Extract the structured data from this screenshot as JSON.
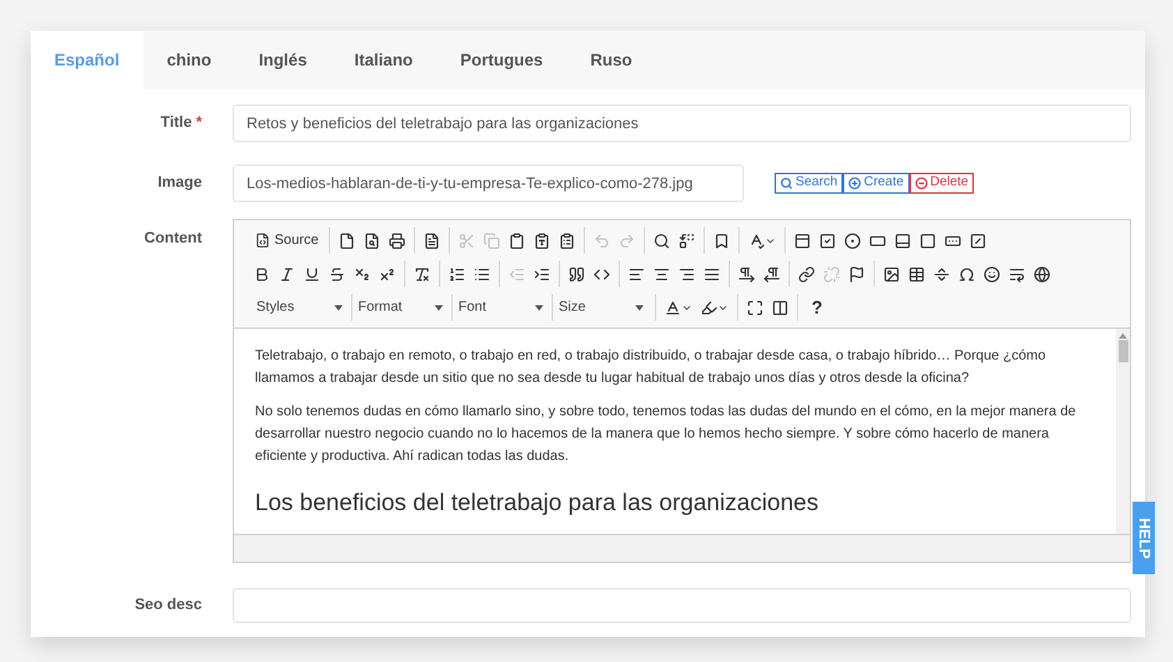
{
  "tabs": [
    {
      "label": "Español",
      "selected": true
    },
    {
      "label": "chino",
      "selected": false
    },
    {
      "label": "Inglés",
      "selected": false
    },
    {
      "label": "Italiano",
      "selected": false
    },
    {
      "label": "Portugues",
      "selected": false
    },
    {
      "label": "Ruso",
      "selected": false
    }
  ],
  "fields": {
    "title": {
      "label": "Title",
      "required_mark": "*",
      "value": "Retos y beneficios del teletrabajo para las organizaciones"
    },
    "image": {
      "label": "Image",
      "value": "Los-medios-hablaran-de-ti-y-tu-empresa-Te-explico-como-278.jpg",
      "buttons": [
        {
          "label": "Search",
          "kind": "search"
        },
        {
          "label": "Create",
          "kind": "create"
        },
        {
          "label": "Delete",
          "kind": "delete"
        }
      ]
    },
    "content": {
      "label": "Content"
    },
    "seo_desc": {
      "label": "Seo desc"
    }
  },
  "toolbar": [
    [
      [
        {
          "kind": "source",
          "label": "Source"
        }
      ],
      [
        {
          "kind": "icon",
          "disabled": false
        },
        {
          "kind": "icon",
          "disabled": false
        },
        {
          "kind": "icon",
          "disabled": false
        }
      ],
      [
        {
          "kind": "icon",
          "disabled": false
        }
      ],
      [
        {
          "kind": "icon",
          "disabled": true
        },
        {
          "kind": "icon",
          "disabled": true
        },
        {
          "kind": "icon",
          "disabled": false
        },
        {
          "kind": "icon",
          "disabled": false
        },
        {
          "kind": "icon",
          "disabled": false
        }
      ],
      [
        {
          "kind": "icon",
          "disabled": true
        },
        {
          "kind": "icon",
          "disabled": true
        }
      ],
      [
        {
          "kind": "icon",
          "disabled": false
        },
        {
          "kind": "icon",
          "disabled": false
        }
      ],
      [
        {
          "kind": "icon",
          "disabled": false
        }
      ],
      [
        {
          "kind": "icon",
          "disabled": false,
          "dropdown": true
        }
      ],
      [
        {
          "kind": "icon",
          "disabled": false
        },
        {
          "kind": "icon",
          "disabled": false
        },
        {
          "kind": "icon",
          "disabled": false
        },
        {
          "kind": "icon",
          "disabled": false
        },
        {
          "kind": "icon",
          "disabled": false
        },
        {
          "kind": "icon",
          "disabled": false
        },
        {
          "kind": "icon",
          "disabled": false
        },
        {
          "kind": "icon",
          "disabled": false
        }
      ]
    ],
    [
      [
        {
          "kind": "icon",
          "disabled": false
        },
        {
          "kind": "icon",
          "disabled": false
        },
        {
          "kind": "icon",
          "disabled": false
        },
        {
          "kind": "icon",
          "disabled": false
        },
        {
          "kind": "icon",
          "disabled": false
        },
        {
          "kind": "icon",
          "disabled": false
        }
      ],
      [
        {
          "kind": "icon",
          "disabled": false
        }
      ],
      [
        {
          "kind": "icon",
          "disabled": false
        },
        {
          "kind": "icon",
          "disabled": false
        }
      ],
      [
        {
          "kind": "icon",
          "disabled": true
        },
        {
          "kind": "icon",
          "disabled": false
        }
      ],
      [
        {
          "kind": "icon",
          "disabled": false
        },
        {
          "kind": "icon",
          "disabled": false
        }
      ],
      [
        {
          "kind": "icon",
          "disabled": false
        },
        {
          "kind": "icon",
          "disabled": false
        },
        {
          "kind": "icon",
          "disabled": false
        },
        {
          "kind": "icon",
          "disabled": false
        }
      ],
      [
        {
          "kind": "icon",
          "disabled": false
        },
        {
          "kind": "icon",
          "disabled": false
        }
      ],
      [
        {
          "kind": "icon",
          "disabled": false
        },
        {
          "kind": "icon",
          "disabled": true
        },
        {
          "kind": "icon",
          "disabled": false
        }
      ],
      [
        {
          "kind": "icon",
          "disabled": false
        },
        {
          "kind": "icon",
          "disabled": false
        },
        {
          "kind": "icon",
          "disabled": false
        },
        {
          "kind": "icon",
          "disabled": false
        },
        {
          "kind": "icon",
          "disabled": false
        },
        {
          "kind": "icon",
          "disabled": false
        },
        {
          "kind": "icon",
          "disabled": false
        }
      ]
    ],
    [
      [
        {
          "kind": "combo",
          "label": "Styles"
        },
        {
          "kind": "combo",
          "label": "Format"
        },
        {
          "kind": "combo",
          "label": "Font"
        },
        {
          "kind": "combo",
          "label": "Size"
        }
      ],
      [
        {
          "kind": "icon",
          "disabled": false,
          "dropdown": true
        },
        {
          "kind": "icon",
          "disabled": false,
          "dropdown": true
        }
      ],
      [
        {
          "kind": "icon",
          "disabled": false
        },
        {
          "kind": "icon",
          "disabled": false
        }
      ],
      [
        {
          "kind": "text",
          "label": "?"
        }
      ]
    ]
  ],
  "editor_body": [
    {
      "kind": "paragraph",
      "text": "Teletrabajo, o trabajo en remoto, o trabajo en red, o trabajo distribuido, o trabajar desde casa, o trabajo híbrido…  Porque ¿cómo llamamos a trabajar desde un sitio que no sea desde tu lugar habitual de trabajo unos días y otros desde la oficina?"
    },
    {
      "kind": "paragraph",
      "text": "No solo tenemos dudas en cómo llamarlo sino, y sobre todo, tenemos todas las dudas del mundo en el cómo, en la mejor manera de desarrollar nuestro negocio cuando no lo hacemos de la manera que lo hemos hecho siempre. Y sobre cómo hacerlo de manera eficiente y productiva. Ahí radican todas las dudas."
    },
    {
      "kind": "heading",
      "text": "Los beneficios del teletrabajo para las organizaciones"
    }
  ],
  "help_tab": "HELP"
}
